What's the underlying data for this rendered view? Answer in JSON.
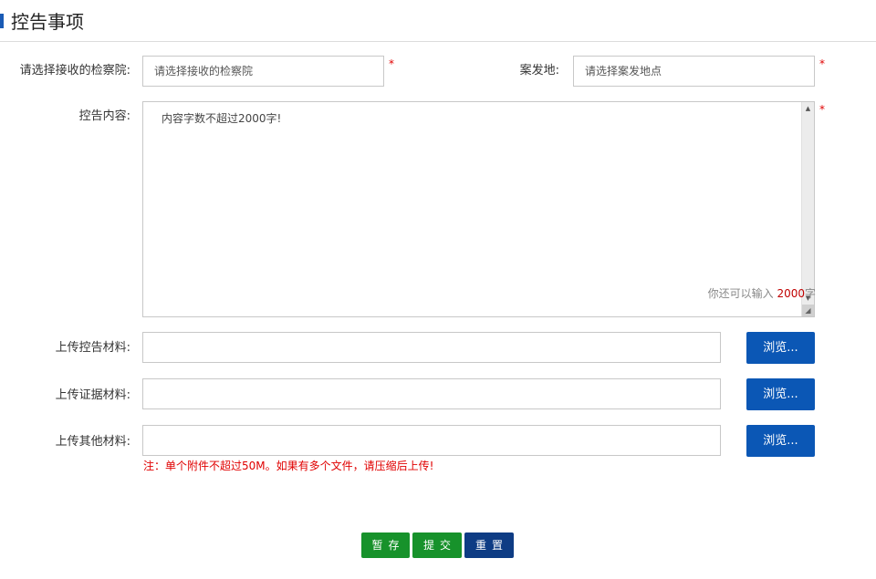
{
  "header": {
    "title": "控告事项"
  },
  "form": {
    "procuratorate": {
      "label": "请选择接收的检察院:",
      "value": "请选择接收的检察院",
      "required": "*"
    },
    "location": {
      "label": "案发地:",
      "value": "请选择案发地点",
      "required": "*"
    },
    "content": {
      "label": "控告内容:",
      "value": "内容字数不超过2000字!",
      "required": "*",
      "counter_prefix": "你还可以输入",
      "counter_value": "2000",
      "counter_suffix": "字"
    },
    "uploads": [
      {
        "label": "上传控告材料:",
        "button": "浏览..."
      },
      {
        "label": "上传证据材料:",
        "button": "浏览..."
      },
      {
        "label": "上传其他材料:",
        "button": "浏览..."
      }
    ],
    "note": "注：单个附件不超过50M。如果有多个文件，请压缩后上传!"
  },
  "actions": {
    "save": "暂存",
    "submit": "提交",
    "reset": "重置"
  },
  "colors": {
    "accent": "#1a5bb5",
    "browse": "#0b57b5",
    "green": "#17922b",
    "navy": "#0e3c84",
    "required": "#e00000"
  },
  "icons": {
    "scroll_up": "triangle-up-icon",
    "scroll_down": "triangle-down-icon",
    "resize": "resize-grip-icon"
  }
}
